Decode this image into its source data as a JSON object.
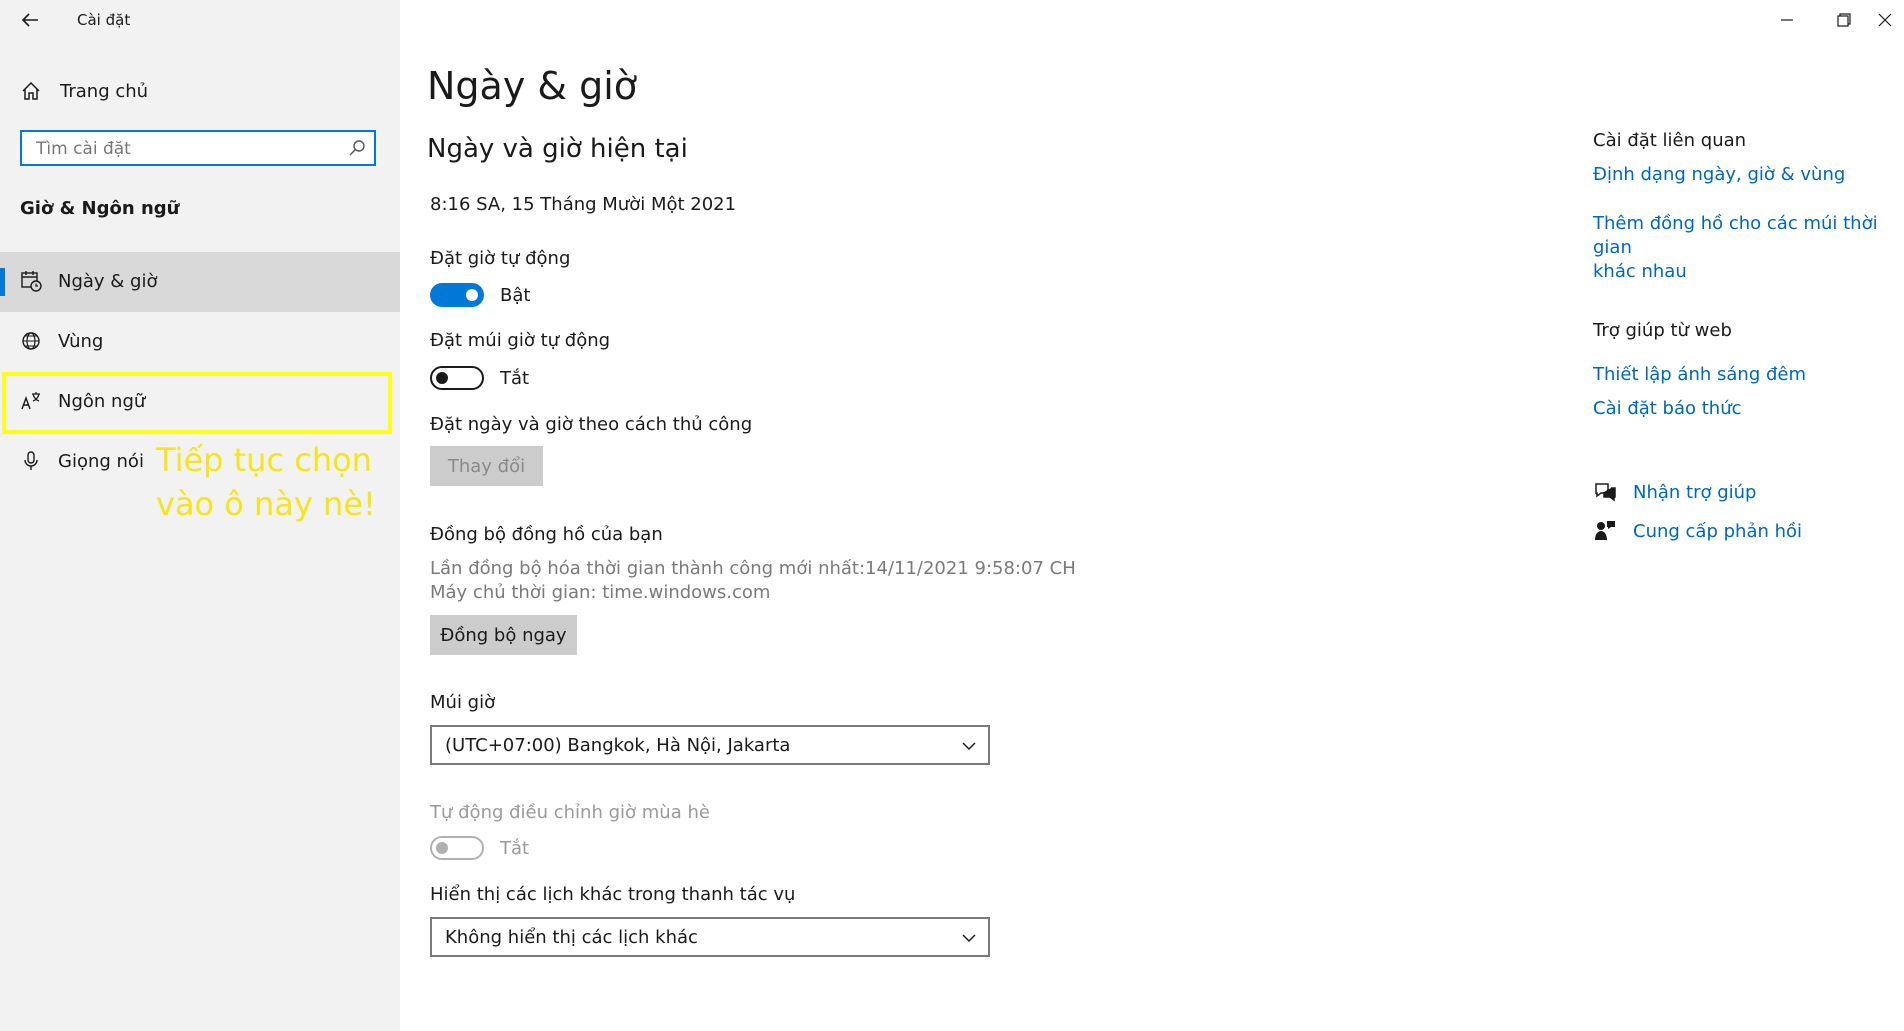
{
  "window": {
    "title": "Cài đặt",
    "controls": [
      "minimize-icon",
      "restore-icon",
      "close-icon"
    ]
  },
  "sidebar": {
    "home_label": "Trang chủ",
    "search_placeholder": "Tìm cài đặt",
    "section_title": "Giờ & Ngôn ngữ",
    "items": [
      {
        "label": "Ngày & giờ",
        "icon": "calendar-clock-icon",
        "selected": true
      },
      {
        "label": "Vùng",
        "icon": "globe-icon",
        "selected": false
      },
      {
        "label": "Ngôn ngữ",
        "icon": "language-icon",
        "selected": false
      },
      {
        "label": "Giọng nói",
        "icon": "microphone-icon",
        "selected": false
      }
    ],
    "annotation": {
      "line1": "Tiếp tục chọn",
      "line2": "vào ô này nè!",
      "color": "#f5e51a",
      "box_color": "#ffff1a"
    }
  },
  "main": {
    "title": "Ngày & giờ",
    "current_heading": "Ngày và giờ hiện tại",
    "current_datetime": "8:16 SA, 15 Tháng Mười Một 2021",
    "auto_time": {
      "label": "Đặt giờ tự động",
      "state": "Bật"
    },
    "auto_timezone": {
      "label": "Đặt múi giờ tự động",
      "state": "Tắt"
    },
    "manual": {
      "label": "Đặt ngày và giờ theo cách thủ công",
      "button": "Thay đổi"
    },
    "sync": {
      "heading": "Đồng bộ đồng hồ của bạn",
      "last_sync": "Lần đồng bộ hóa thời gian thành công mới nhất:14/11/2021 9:58:07 CH",
      "server": "Máy chủ thời gian: time.windows.com",
      "button": "Đồng bộ ngay"
    },
    "timezone": {
      "label": "Múi giờ",
      "value": "(UTC+07:00) Bangkok, Hà Nội, Jakarta"
    },
    "dst": {
      "label": "Tự động điều chỉnh giờ mùa hè",
      "state": "Tắt"
    },
    "calendars": {
      "label": "Hiển thị các lịch khác trong thanh tác vụ",
      "value": "Không hiển thị các lịch khác"
    }
  },
  "related": {
    "heading": "Cài đặt liên quan",
    "link1": "Định dạng ngày, giờ & vùng",
    "link2_line1": "Thêm đồng hồ cho các múi thời gian",
    "link2_line2": "khác nhau",
    "web_help_heading": "Trợ giúp từ web",
    "web_link1": "Thiết lập ánh sáng đêm",
    "web_link2": "Cài đặt báo thức",
    "get_help": "Nhận trợ giúp",
    "feedback": "Cung cấp phản hồi"
  },
  "colors": {
    "accent": "#0078d7",
    "link": "#0067b8",
    "sidebar_bg": "#f2f2f2"
  }
}
